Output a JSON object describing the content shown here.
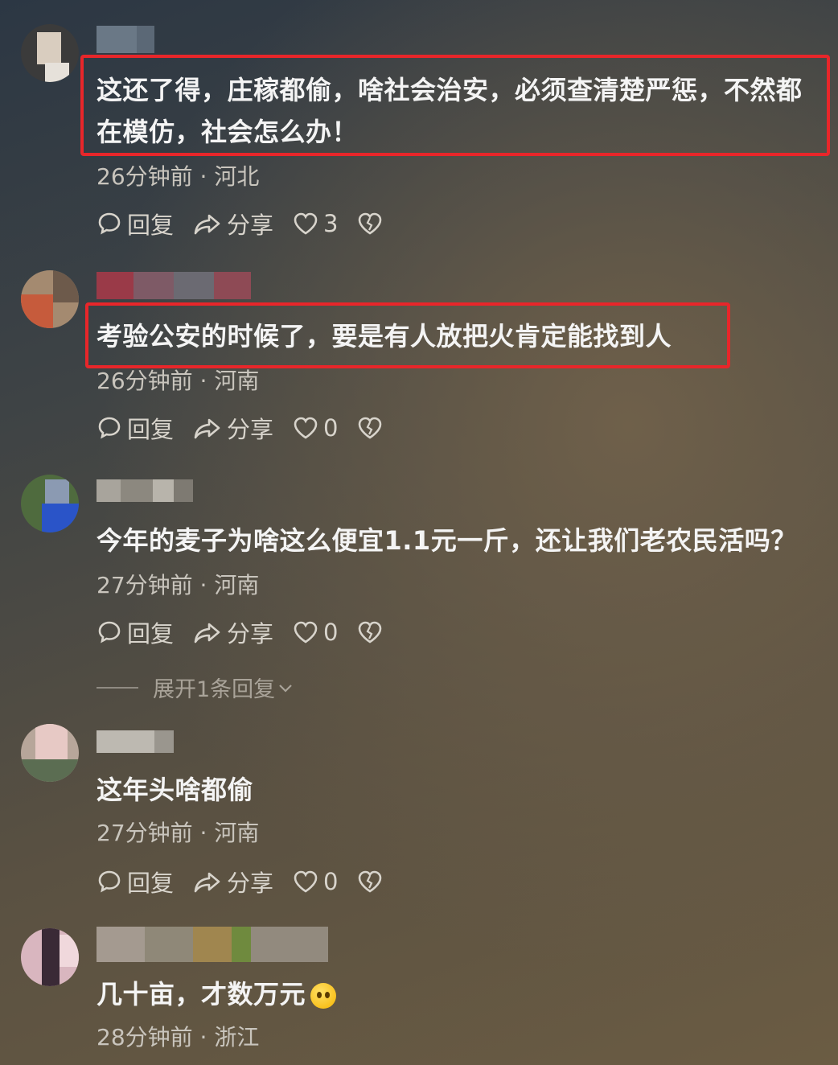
{
  "comments": [
    {
      "text": "这还了得，庄稼都偷，啥社会治安，必须查清楚严惩，不然都在模仿，社会怎么办！",
      "time": "26分钟前",
      "location": "河北",
      "reply_label": "回复",
      "share_label": "分享",
      "likes": "3",
      "highlighted": true
    },
    {
      "text": "考验公安的时候了，要是有人放把火肯定能找到人",
      "time": "26分钟前",
      "location": "河南",
      "reply_label": "回复",
      "share_label": "分享",
      "likes": "0",
      "highlighted": true
    },
    {
      "text": "今年的麦子为啥这么便宜1.1元一斤，还让我们老农民活吗？",
      "time": "27分钟前",
      "location": "河南",
      "reply_label": "回复",
      "share_label": "分享",
      "likes": "0",
      "highlighted": false,
      "expand_label": "展开1条回复"
    },
    {
      "text": "这年头啥都偷",
      "time": "27分钟前",
      "location": "河南",
      "reply_label": "回复",
      "share_label": "分享",
      "likes": "0",
      "highlighted": false
    },
    {
      "text": "几十亩，才数万元",
      "time": "28分钟前",
      "location": "浙江",
      "emoji": "pleading-face-icon",
      "highlighted": false
    }
  ],
  "separator": "·",
  "colors": {
    "highlight_border": "#e8262a",
    "text": "#f4f4f4",
    "meta": "#c9c5bd"
  }
}
